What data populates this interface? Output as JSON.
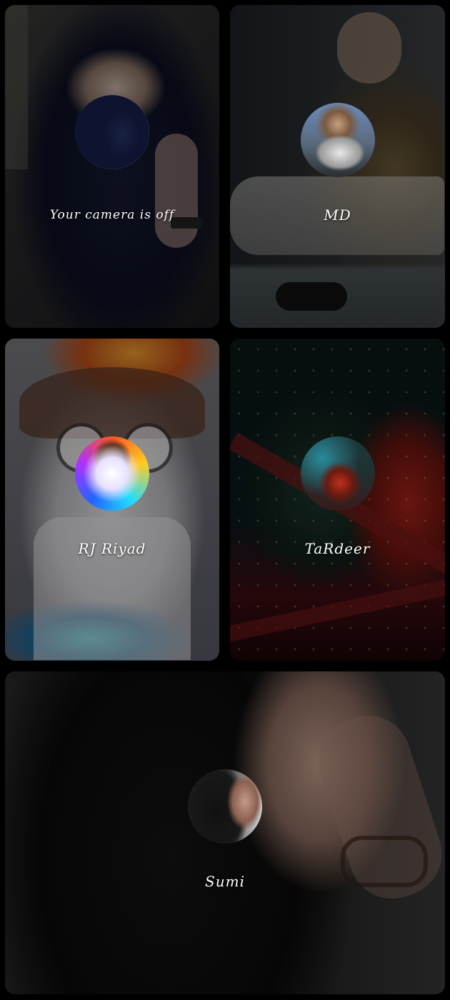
{
  "participants": [
    {
      "id": "self",
      "label": "Your camera is off"
    },
    {
      "id": "p2",
      "label": "MD"
    },
    {
      "id": "p3",
      "label": "RJ  Riyad"
    },
    {
      "id": "p4",
      "label": "TaRdeer"
    },
    {
      "id": "p5",
      "label": "Sumi"
    }
  ]
}
